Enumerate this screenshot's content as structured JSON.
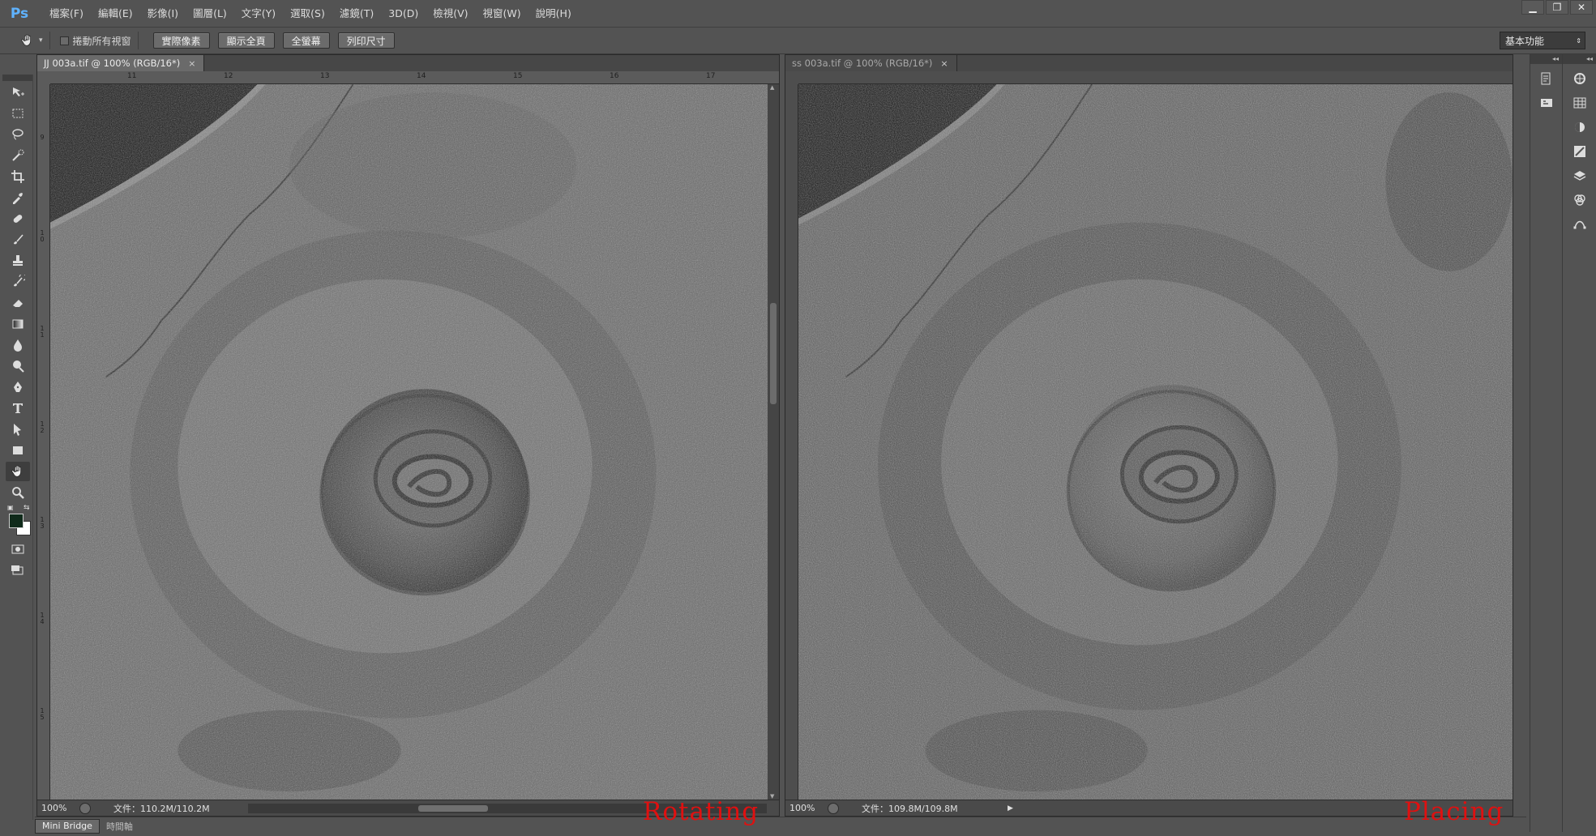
{
  "app": {
    "logo": "Ps"
  },
  "menu": [
    "檔案(F)",
    "編輯(E)",
    "影像(I)",
    "圖層(L)",
    "文字(Y)",
    "選取(S)",
    "濾鏡(T)",
    "3D(D)",
    "檢視(V)",
    "視窗(W)",
    "說明(H)"
  ],
  "window_controls": {
    "minimize": "▁",
    "restore": "❐",
    "close": "✕"
  },
  "options": {
    "scroll_all_label": "捲動所有視窗",
    "buttons": [
      "實際像素",
      "顯示全頁",
      "全螢幕",
      "列印尺寸"
    ],
    "workspace": "基本功能"
  },
  "doc_left": {
    "tab_title": "JJ 003a.tif @ 100% (RGB/16*)",
    "close": "×",
    "ruler_h": [
      "11",
      "12",
      "13",
      "14",
      "15",
      "16",
      "17"
    ],
    "ruler_v": [
      "9",
      "1 0",
      "1 1",
      "1 2",
      "1 3",
      "1 4",
      "1 5"
    ],
    "zoom": "100%",
    "file_info": "文件：110.2M/110.2M",
    "arrow": "▶",
    "label": "Rotating"
  },
  "doc_right": {
    "tab_title": "ss 003a.tif @ 100% (RGB/16*)",
    "close": "×",
    "zoom": "100%",
    "file_info": "文件：109.8M/109.8M",
    "arrow": "▶",
    "label": "Placing"
  },
  "bottom_tabs": [
    "Mini Bridge",
    "時間軸"
  ],
  "dock_collapse": "◂◂",
  "colors": {
    "foreground": "#0f2a1a",
    "background": "#ffffff",
    "accent": "#5fb3ff",
    "label_red": "#e01010"
  }
}
